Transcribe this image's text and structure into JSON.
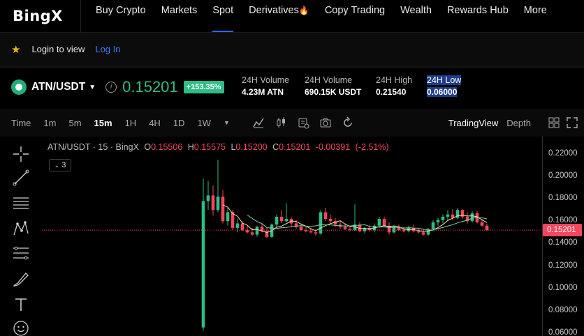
{
  "brand": {
    "name": "BingX"
  },
  "nav": {
    "items": [
      {
        "label": "Buy Crypto",
        "active": false
      },
      {
        "label": "Markets",
        "active": false
      },
      {
        "label": "Spot",
        "active": true
      },
      {
        "label": "Derivatives",
        "active": false,
        "hot": true
      },
      {
        "label": "Copy Trading",
        "active": false
      },
      {
        "label": "Wealth",
        "active": false
      },
      {
        "label": "Rewards Hub",
        "active": false
      },
      {
        "label": "More",
        "active": false
      }
    ]
  },
  "login_bar": {
    "text": "Login to view",
    "link": "Log In"
  },
  "ticker": {
    "pair": "ATN/USDT",
    "price": "0.15201",
    "change": "+153.35%",
    "stats": [
      {
        "label": "24H Volume",
        "value": "4.23M ATN"
      },
      {
        "label": "24H Volume",
        "value": "690.15K USDT"
      },
      {
        "label": "24H High",
        "value": "0.21540"
      },
      {
        "label": "24H Low",
        "value": "0.06000",
        "highlighted": true
      }
    ]
  },
  "toolbar": {
    "timeframes": [
      {
        "label": "Time",
        "active": false
      },
      {
        "label": "1m",
        "active": false
      },
      {
        "label": "5m",
        "active": false
      },
      {
        "label": "15m",
        "active": true
      },
      {
        "label": "1H",
        "active": false
      },
      {
        "label": "4H",
        "active": false
      },
      {
        "label": "1D",
        "active": false
      },
      {
        "label": "1W",
        "active": false
      }
    ],
    "tools": [
      "indicator-icon",
      "candle-type-icon",
      "settings-icon",
      "screenshot-icon",
      "refresh-icon"
    ],
    "views": [
      {
        "label": "TradingView",
        "active": true
      },
      {
        "label": "Depth",
        "active": false
      }
    ]
  },
  "left_tools": [
    "crosshair-icon",
    "trendline-icon",
    "horizontal-lines-icon",
    "pattern-icon",
    "fib-icon",
    "brush-icon",
    "text-icon",
    "emoji-icon"
  ],
  "legend": {
    "symbol": "ATN/USDT",
    "interval": "15",
    "exchange": "BingX",
    "open": "0.15506",
    "high": "0.15575",
    "low": "0.15200",
    "close": "0.15201",
    "change": "-0.00391",
    "change_pct": "(-2.51%)",
    "collapse_count": "3"
  },
  "colors": {
    "up": "#2ebd85",
    "down": "#f5465c",
    "accent": "#2a6df5"
  },
  "chart_data": {
    "type": "candlestick",
    "title": "",
    "xlabel": "",
    "ylabel": "",
    "ylim": [
      0.06,
      0.23
    ],
    "y_ticks": [
      "0.22000",
      "0.20000",
      "0.18000",
      "0.16000",
      "0.14000",
      "0.12000",
      "0.10000",
      "0.08000",
      "0.06000"
    ],
    "last_price": "0.15201",
    "candles": [
      {
        "o": 0.065,
        "h": 0.198,
        "l": 0.062,
        "c": 0.178
      },
      {
        "o": 0.178,
        "h": 0.196,
        "l": 0.17,
        "c": 0.183
      },
      {
        "o": 0.183,
        "h": 0.192,
        "l": 0.165,
        "c": 0.17
      },
      {
        "o": 0.17,
        "h": 0.215,
        "l": 0.168,
        "c": 0.182
      },
      {
        "o": 0.182,
        "h": 0.188,
        "l": 0.158,
        "c": 0.16
      },
      {
        "o": 0.16,
        "h": 0.172,
        "l": 0.156,
        "c": 0.168
      },
      {
        "o": 0.168,
        "h": 0.17,
        "l": 0.152,
        "c": 0.154
      },
      {
        "o": 0.154,
        "h": 0.162,
        "l": 0.15,
        "c": 0.158
      },
      {
        "o": 0.158,
        "h": 0.16,
        "l": 0.151,
        "c": 0.152
      },
      {
        "o": 0.152,
        "h": 0.156,
        "l": 0.149,
        "c": 0.15
      },
      {
        "o": 0.15,
        "h": 0.154,
        "l": 0.147,
        "c": 0.148
      },
      {
        "o": 0.148,
        "h": 0.156,
        "l": 0.146,
        "c": 0.155
      },
      {
        "o": 0.155,
        "h": 0.158,
        "l": 0.15,
        "c": 0.151
      },
      {
        "o": 0.151,
        "h": 0.154,
        "l": 0.145,
        "c": 0.146
      },
      {
        "o": 0.146,
        "h": 0.158,
        "l": 0.145,
        "c": 0.157
      },
      {
        "o": 0.157,
        "h": 0.166,
        "l": 0.155,
        "c": 0.164
      },
      {
        "o": 0.164,
        "h": 0.17,
        "l": 0.158,
        "c": 0.16
      },
      {
        "o": 0.16,
        "h": 0.176,
        "l": 0.159,
        "c": 0.162
      },
      {
        "o": 0.162,
        "h": 0.164,
        "l": 0.155,
        "c": 0.158
      },
      {
        "o": 0.158,
        "h": 0.161,
        "l": 0.153,
        "c": 0.155
      },
      {
        "o": 0.155,
        "h": 0.158,
        "l": 0.151,
        "c": 0.152
      },
      {
        "o": 0.152,
        "h": 0.155,
        "l": 0.15,
        "c": 0.151
      },
      {
        "o": 0.151,
        "h": 0.154,
        "l": 0.149,
        "c": 0.15
      },
      {
        "o": 0.15,
        "h": 0.153,
        "l": 0.147,
        "c": 0.149
      },
      {
        "o": 0.149,
        "h": 0.17,
        "l": 0.148,
        "c": 0.168
      },
      {
        "o": 0.168,
        "h": 0.172,
        "l": 0.16,
        "c": 0.162
      },
      {
        "o": 0.162,
        "h": 0.166,
        "l": 0.158,
        "c": 0.16
      },
      {
        "o": 0.16,
        "h": 0.163,
        "l": 0.155,
        "c": 0.157
      },
      {
        "o": 0.157,
        "h": 0.16,
        "l": 0.153,
        "c": 0.155
      },
      {
        "o": 0.155,
        "h": 0.158,
        "l": 0.152,
        "c": 0.153
      },
      {
        "o": 0.153,
        "h": 0.156,
        "l": 0.151,
        "c": 0.152
      },
      {
        "o": 0.152,
        "h": 0.175,
        "l": 0.151,
        "c": 0.157
      },
      {
        "o": 0.157,
        "h": 0.159,
        "l": 0.15,
        "c": 0.151
      },
      {
        "o": 0.151,
        "h": 0.155,
        "l": 0.149,
        "c": 0.154
      },
      {
        "o": 0.154,
        "h": 0.157,
        "l": 0.151,
        "c": 0.152
      },
      {
        "o": 0.152,
        "h": 0.158,
        "l": 0.15,
        "c": 0.156
      },
      {
        "o": 0.156,
        "h": 0.164,
        "l": 0.154,
        "c": 0.162
      },
      {
        "o": 0.162,
        "h": 0.164,
        "l": 0.155,
        "c": 0.156
      },
      {
        "o": 0.156,
        "h": 0.159,
        "l": 0.148,
        "c": 0.15
      },
      {
        "o": 0.15,
        "h": 0.156,
        "l": 0.149,
        "c": 0.155
      },
      {
        "o": 0.155,
        "h": 0.157,
        "l": 0.151,
        "c": 0.152
      },
      {
        "o": 0.152,
        "h": 0.155,
        "l": 0.15,
        "c": 0.151
      },
      {
        "o": 0.151,
        "h": 0.156,
        "l": 0.15,
        "c": 0.154
      },
      {
        "o": 0.154,
        "h": 0.157,
        "l": 0.15,
        "c": 0.151
      },
      {
        "o": 0.151,
        "h": 0.154,
        "l": 0.149,
        "c": 0.15
      },
      {
        "o": 0.15,
        "h": 0.153,
        "l": 0.147,
        "c": 0.148
      },
      {
        "o": 0.148,
        "h": 0.154,
        "l": 0.147,
        "c": 0.153
      },
      {
        "o": 0.153,
        "h": 0.161,
        "l": 0.151,
        "c": 0.159
      },
      {
        "o": 0.159,
        "h": 0.163,
        "l": 0.156,
        "c": 0.161
      },
      {
        "o": 0.161,
        "h": 0.166,
        "l": 0.158,
        "c": 0.164
      },
      {
        "o": 0.164,
        "h": 0.17,
        "l": 0.16,
        "c": 0.166
      },
      {
        "o": 0.166,
        "h": 0.171,
        "l": 0.161,
        "c": 0.163
      },
      {
        "o": 0.163,
        "h": 0.172,
        "l": 0.162,
        "c": 0.17
      },
      {
        "o": 0.17,
        "h": 0.171,
        "l": 0.162,
        "c": 0.164
      },
      {
        "o": 0.164,
        "h": 0.168,
        "l": 0.158,
        "c": 0.16
      },
      {
        "o": 0.16,
        "h": 0.169,
        "l": 0.159,
        "c": 0.167
      },
      {
        "o": 0.167,
        "h": 0.169,
        "l": 0.158,
        "c": 0.159
      },
      {
        "o": 0.159,
        "h": 0.162,
        "l": 0.155,
        "c": 0.156
      },
      {
        "o": 0.156,
        "h": 0.158,
        "l": 0.151,
        "c": 0.152
      }
    ]
  }
}
